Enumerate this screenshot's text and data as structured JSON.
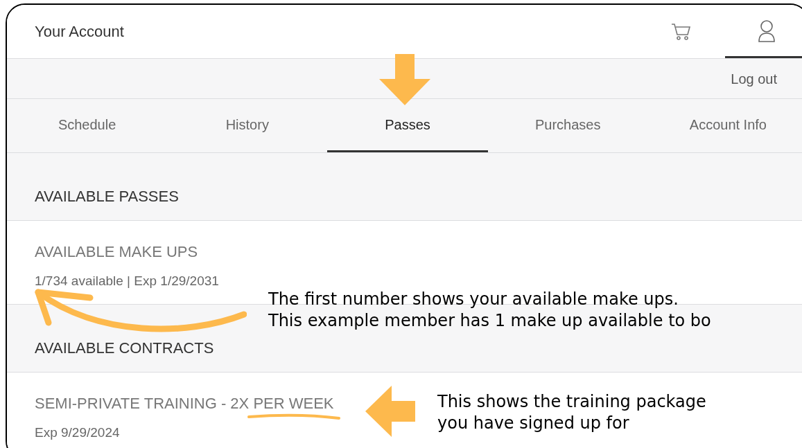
{
  "header": {
    "title": "Your Account",
    "account_selected": true
  },
  "log_out": "Log out",
  "tabs": [
    {
      "label": "Schedule",
      "selected": false
    },
    {
      "label": "History",
      "selected": false
    },
    {
      "label": "Passes",
      "selected": true
    },
    {
      "label": "Purchases",
      "selected": false
    },
    {
      "label": "Account Info",
      "selected": false
    }
  ],
  "sections": [
    {
      "heading": "AVAILABLE PASSES",
      "items": [
        {
          "title": "AVAILABLE MAKE UPS",
          "detail": "1/734 available | Exp 1/29/2031"
        }
      ]
    },
    {
      "heading": "AVAILABLE CONTRACTS",
      "items": [
        {
          "title": "SEMI-PRIVATE TRAINING - 2X PER WEEK",
          "detail": "Exp 9/29/2024"
        }
      ]
    }
  ],
  "annotations": [
    {
      "lines": [
        "The first number shows your available make ups.",
        "This example member has 1 make up available to bo"
      ]
    },
    {
      "lines": [
        "This shows the training package",
        "you have signed up for"
      ]
    }
  ]
}
